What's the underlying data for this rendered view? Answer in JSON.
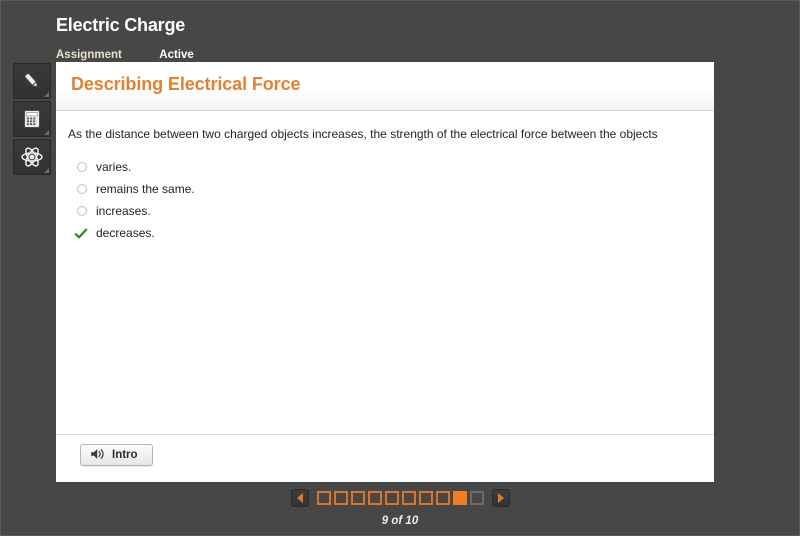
{
  "header": {
    "app_title": "Electric Charge",
    "tabs": [
      {
        "label": "Assignment",
        "state": "selected"
      },
      {
        "label": "Active",
        "state": "normal"
      }
    ]
  },
  "sidebar": {
    "tools": [
      {
        "icon": "pencil-icon",
        "name": "highlighter-tool"
      },
      {
        "icon": "calculator-icon",
        "name": "calculator-tool"
      },
      {
        "icon": "atom-icon",
        "name": "periodic-table-tool"
      }
    ]
  },
  "content": {
    "title": "Describing Electrical Force",
    "question": "As the distance between two charged objects increases, the strength of the electrical force between the objects",
    "options": [
      {
        "label": "varies.",
        "marker": "radio",
        "selected": false
      },
      {
        "label": "remains the same.",
        "marker": "radio",
        "selected": false
      },
      {
        "label": "increases.",
        "marker": "radio",
        "selected": false
      },
      {
        "label": "decreases.",
        "marker": "check",
        "selected": true
      }
    ]
  },
  "footer": {
    "intro_label": "Intro",
    "intro_icon": "speaker-icon"
  },
  "pagination": {
    "prev_icon": "triangle-left-icon",
    "next_icon": "triangle-right-icon",
    "counter": "9 of 10",
    "current_page": 9,
    "total_pages": 10,
    "pages": [
      {
        "number": 1,
        "state": "visited"
      },
      {
        "number": 2,
        "state": "visited"
      },
      {
        "number": 3,
        "state": "visited"
      },
      {
        "number": 4,
        "state": "visited"
      },
      {
        "number": 5,
        "state": "visited"
      },
      {
        "number": 6,
        "state": "visited"
      },
      {
        "number": 7,
        "state": "visited"
      },
      {
        "number": 8,
        "state": "visited"
      },
      {
        "number": 9,
        "state": "current"
      },
      {
        "number": 10,
        "state": "unvisited"
      }
    ]
  },
  "colors": {
    "canvas": "#474747",
    "accent_orange": "#e08233",
    "page_current": "#ef7f22",
    "page_visited_border": "#d9742a",
    "page_unvisited_border": "#6b6b6b",
    "check_green": "#2f8a2f",
    "tab_selected": "#e8e0cb"
  }
}
